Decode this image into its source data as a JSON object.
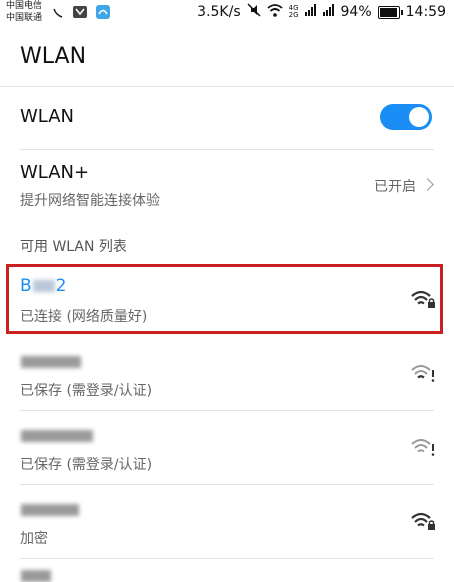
{
  "status_bar": {
    "carrier_1": "中国电信",
    "carrier_2": "中国联通",
    "speed": "3.5K/s",
    "net_type_top": "4G",
    "net_type_bottom": "2G",
    "battery_percent": "94%",
    "battery_level": 0.94,
    "time": "14:59"
  },
  "header": {
    "title": "WLAN"
  },
  "wlan_toggle": {
    "label": "WLAN",
    "enabled": true
  },
  "wlan_plus": {
    "label": "WLAN+",
    "description": "提升网络智能连接体验",
    "status": "已开启"
  },
  "available_list": {
    "header": "可用 WLAN 列表",
    "networks": [
      {
        "name_prefix": "B",
        "name_suffix": "2",
        "status": "已连接 (网络质量好)",
        "connected": true
      },
      {
        "name_prefix": "",
        "name_suffix": "",
        "status": "已保存 (需登录/认证)",
        "connected": false
      },
      {
        "name_prefix": "",
        "name_suffix": "",
        "status": "已保存 (需登录/认证)",
        "connected": false
      },
      {
        "name_prefix": "",
        "name_suffix": "",
        "status": "加密",
        "connected": false
      }
    ]
  },
  "colors": {
    "accent": "#1a8ef5",
    "highlight": "#cc1f1f"
  }
}
